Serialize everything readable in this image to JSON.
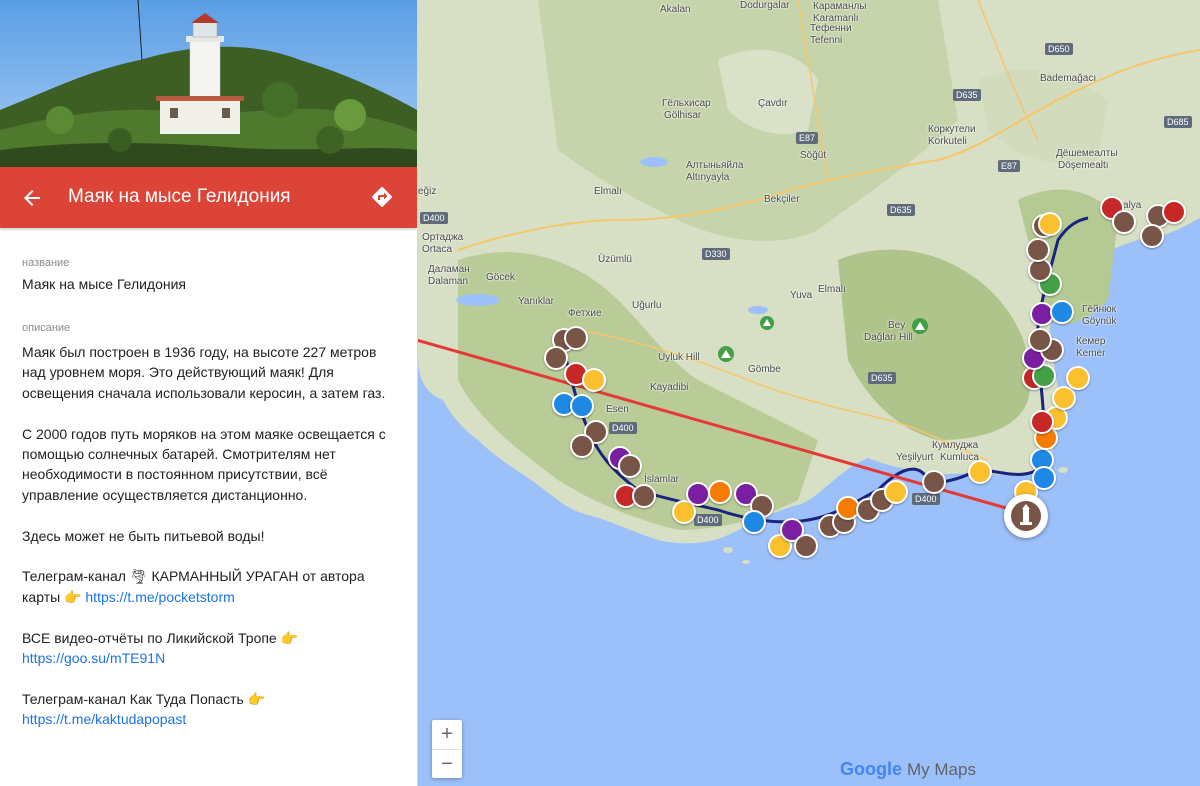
{
  "place": {
    "title": "Маяк на мысе Гелидония",
    "name_label": "название",
    "name_value": "Маяк на мысе Гелидония",
    "description_label": "описание",
    "paragraphs": {
      "p1": "Маяк был построен в 1936 году, на высоте 227 метров над уровнем моря. Это действующий маяк! Для освещения сначала использовали керосин, а затем газ.",
      "p2": "С 2000 годов путь моряков на этом маяке освещается с помощью солнечных батарей. Смотрителям нет необходимости в постоянном присутствии, всё управление осуществляется дистанционно.",
      "p3": "Здесь может не быть питьевой воды!",
      "p4_text": "Телеграм-канал 🌪 КАРМАННЫЙ УРАГАН от автора карты 👉",
      "p4_link": "https://t.me/pocketstorm",
      "p5_text": "ВСЕ видео-отчёты по Ликийской Тропе 👉",
      "p5_link": "https://goo.su/mTE91N",
      "p6_text": "Телеграм-канал Как Туда Попасть 👉",
      "p6_link": "https://t.me/kaktudapopast"
    }
  },
  "map": {
    "labels": {
      "akalan": "Akalan",
      "dodurgalar": "Dodurgalar",
      "karamanli_tr": "Караманлы",
      "karamanli": "Karamanlı",
      "tefenni_tr": "Тефенни",
      "tefenni": "Tefenni",
      "gelkhisar_tr": "Гёльхисар",
      "golhisar": "Gölhisar",
      "cavdir": "Çavdır",
      "korkuteli_tr": "Коркутели",
      "korkuteli": "Korkuteli",
      "bademagaci": "Bademağacı",
      "sogut": "Söğüt",
      "altinyayla_tr": "Алтыньяйла",
      "altinyayla": "Altınyayla",
      "elmali1": "Elmalı",
      "begci": "Bekçiler",
      "deshemealty_tr": "Дёшемеалты",
      "dosemealti": "Döşemealtı",
      "egiz": "eğiz",
      "ortaca_tr": "Ортаджа",
      "ortaca": "Ortaca",
      "dalaman_tr": "Даламан",
      "dalaman": "Dalaman",
      "gocek": "Göcek",
      "uzumlu": "Üzümlü",
      "elmali2": "Elmalı",
      "yuva": "Yuva",
      "yaniklar": "Yanıklar",
      "fethiye_tr": "Фетхие",
      "ugurlu": "Uğurlu",
      "bey": "Bey",
      "daglari": "Dağları Hill",
      "uyluk": "Uyluk Hill",
      "kayadibi": "Kayadibi",
      "gombe": "Gömbe",
      "kemer_tr": "Кемер",
      "kemer": "Kemer",
      "esen": "Esen",
      "kumludja_tr": "Кумлуджа",
      "kumluca": "Kumluca",
      "yesilyurt": "Yeşilyurt",
      "islamlar": "İslamlar",
      "antalya": "Antalya",
      "aneshik": "Гёйнюк",
      "goynuk": "Göynük"
    },
    "roads": {
      "d650": "D650",
      "d635a": "D635",
      "d685": "D685",
      "e87a": "E87",
      "e87b": "E87",
      "d400a": "D400",
      "d635b": "D635",
      "d330": "D330",
      "d635c": "D635",
      "d400b": "D400",
      "d400c": "D400",
      "d400d": "D400"
    },
    "zoom_in": "+",
    "zoom_out": "−",
    "brand_google": "Google",
    "brand_mymaps": "My Maps"
  }
}
